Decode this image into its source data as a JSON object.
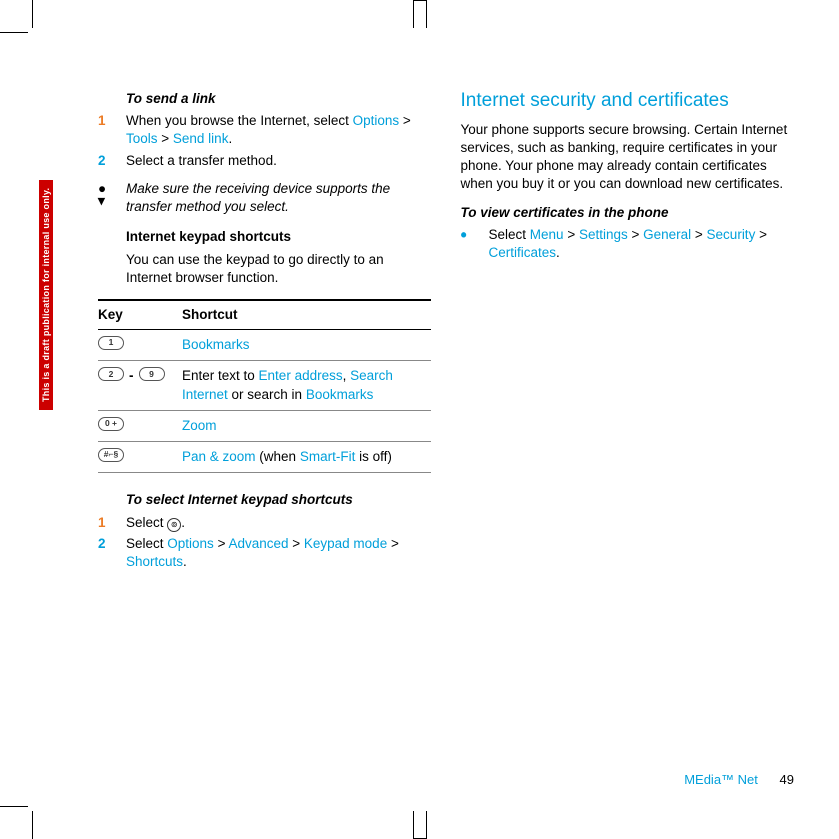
{
  "sidetab": "This is a draft publication for internal use only.",
  "left": {
    "sendLink": {
      "heading": "To send a link",
      "step1_a": "When you browse the Internet, select ",
      "step1_nav": [
        "Options",
        "Tools",
        "Send link"
      ],
      "step1_dot": ".",
      "step2": "Select a transfer method."
    },
    "note": "Make sure the receiving device supports the transfer method you select.",
    "keypad": {
      "heading": "Internet keypad shortcuts",
      "intro": "You can use the keypad to go directly to an Internet browser function.",
      "colKey": "Key",
      "colShortcut": "Shortcut",
      "rows": [
        {
          "key1": "1",
          "key2": "",
          "shortcut_link": "Bookmarks",
          "shortcut_pre": "",
          "shortcut_mid": "",
          "shortcut_link2": "",
          "shortcut_mid2": "",
          "shortcut_link3": ""
        },
        {
          "key1": "2",
          "key2": "9",
          "shortcut_pre": "Enter text to ",
          "shortcut_link": "Enter address",
          "shortcut_mid": ", ",
          "shortcut_link2": "Search Internet",
          "shortcut_mid2": " or search in ",
          "shortcut_link3": "Bookmarks"
        },
        {
          "key1": "0 +",
          "key2": "",
          "shortcut_link": "Zoom",
          "shortcut_pre": "",
          "shortcut_mid": "",
          "shortcut_link2": "",
          "shortcut_mid2": "",
          "shortcut_link3": ""
        },
        {
          "key1": "#⌐§",
          "key2": "",
          "shortcut_link": "Pan & zoom",
          "shortcut_pre": "",
          "shortcut_mid": " (when ",
          "shortcut_link2": "Smart-Fit",
          "shortcut_mid2": " is off)",
          "shortcut_link3": ""
        }
      ]
    },
    "selectShortcuts": {
      "heading": "To select Internet keypad shortcuts",
      "step1_a": "Select ",
      "step1_b": ".",
      "step2_a": "Select ",
      "step2_nav": [
        "Options",
        "Advanced",
        "Keypad mode",
        "Shortcuts"
      ],
      "step2_dot": "."
    }
  },
  "right": {
    "heading": "Internet security and certificates",
    "body": "Your phone supports secure browsing. Certain Internet services, such as banking, require certificates in your phone. Your phone may already contain certificates when you buy it or you can download new certificates.",
    "subheading": "To view certificates in the phone",
    "bullet_a": "Select ",
    "bullet_nav": [
      "Menu",
      "Settings",
      "General",
      "Security",
      "Certificates"
    ],
    "bullet_dot": "."
  },
  "footer": {
    "label": "MEdia™ Net",
    "page": "49"
  }
}
